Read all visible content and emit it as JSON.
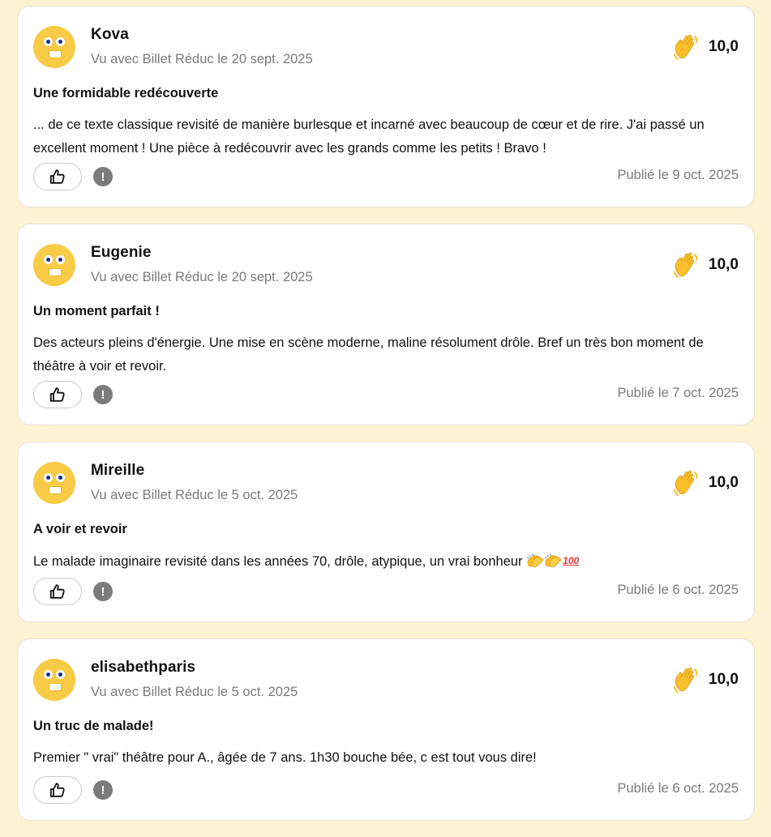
{
  "reviews": [
    {
      "name": "Kova",
      "seen_with": "Vu avec Billet Réduc le 20 sept. 2025",
      "rating": "10,0",
      "title": "Une formidable redécouverte",
      "body": "... de ce texte classique revisité de manière burlesque et incarné avec beaucoup de cœur et de rire. J'ai passé un excellent moment ! Une pièce à redécouvrir avec les grands comme les petits ! Bravo !",
      "published": "Publié le 9 oct. 2025",
      "rating_icon": "waving-hand-icon",
      "like_icon": "thumbs-up-icon",
      "report_icon": "exclamation-icon"
    },
    {
      "name": "Eugenie",
      "seen_with": "Vu avec Billet Réduc le 20 sept. 2025",
      "rating": "10,0",
      "title": "Un moment parfait !",
      "body": "Des acteurs pleins d'énergie. Une mise en scène moderne, maline résolument drôle. Bref un très bon moment de théâtre à voir et revoir.",
      "published": "Publié le 7 oct. 2025",
      "rating_icon": "waving-hand-icon",
      "like_icon": "thumbs-up-icon",
      "report_icon": "exclamation-icon"
    },
    {
      "name": "Mireille",
      "seen_with": "Vu avec Billet Réduc le 5 oct. 2025",
      "rating": "10,0",
      "title": "A voir et revoir",
      "body": "Le malade imaginaire revisité dans les années 70, drôle, atypique, un vrai bonheur",
      "body_emojis": [
        "clapping-hands-emoji",
        "clapping-hands-emoji",
        "hundred-points-emoji"
      ],
      "hundred_text": "100",
      "published": "Publié le 6 oct. 2025",
      "rating_icon": "waving-hand-icon",
      "like_icon": "thumbs-up-icon",
      "report_icon": "exclamation-icon"
    },
    {
      "name": "elisabethparis",
      "seen_with": "Vu avec Billet Réduc le 5 oct. 2025",
      "rating": "10,0",
      "title": "Un truc de malade!",
      "body": "Premier \" vrai\" théâtre pour A., âgée de 7 ans. 1h30 bouche bée, c est tout vous dire!",
      "published": "Publié le 6 oct. 2025",
      "rating_icon": "waving-hand-icon",
      "like_icon": "thumbs-up-icon",
      "report_icon": "exclamation-icon"
    }
  ],
  "report_glyph": "!",
  "colors": {
    "page_background": "#fdf3d2",
    "card_background": "#ffffff",
    "avatar": "#f7cb45",
    "muted_text": "#7a7a7a",
    "rating_emoji": "#f9bf2b"
  }
}
